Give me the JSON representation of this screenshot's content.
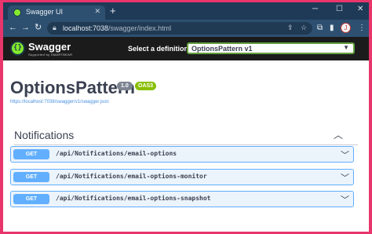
{
  "browser": {
    "tab_title": "Swagger UI",
    "tab_close": "✕",
    "new_tab": "+",
    "controls": {
      "minimize": "─",
      "maximize": "☐",
      "close": "✕"
    },
    "nav": {
      "back": "←",
      "forward": "→",
      "reload": "↻"
    },
    "url_host": "localhost:7038",
    "url_path": "/swagger/index.html",
    "profile_initial": "J"
  },
  "swagger": {
    "logo_glyph": "{}",
    "logo_text": "Swagger",
    "logo_sub": "Supported by SMARTBEAR",
    "definition_label": "Select a definition",
    "definition_value": "OptionsPattern v1"
  },
  "info": {
    "title": "OptionsPattern",
    "version": "1.0",
    "oas": "OAS3",
    "spec_url": "https://localhost:7038/swagger/v1/swagger.json"
  },
  "tag": {
    "name": "Notifications"
  },
  "operations": [
    {
      "method": "GET",
      "path": "/api/Notifications/email-options"
    },
    {
      "method": "GET",
      "path": "/api/Notifications/email-options-monitor"
    },
    {
      "method": "GET",
      "path": "/api/Notifications/email-options-snapshot"
    }
  ],
  "colors": {
    "frame": "#e8356b",
    "titlebar": "#1f3a57",
    "topbar": "#1b1b1b",
    "get_method": "#61affe",
    "get_bg": "#ebf3fb",
    "oas_badge": "#89bf04",
    "select_border": "#62a03f"
  }
}
